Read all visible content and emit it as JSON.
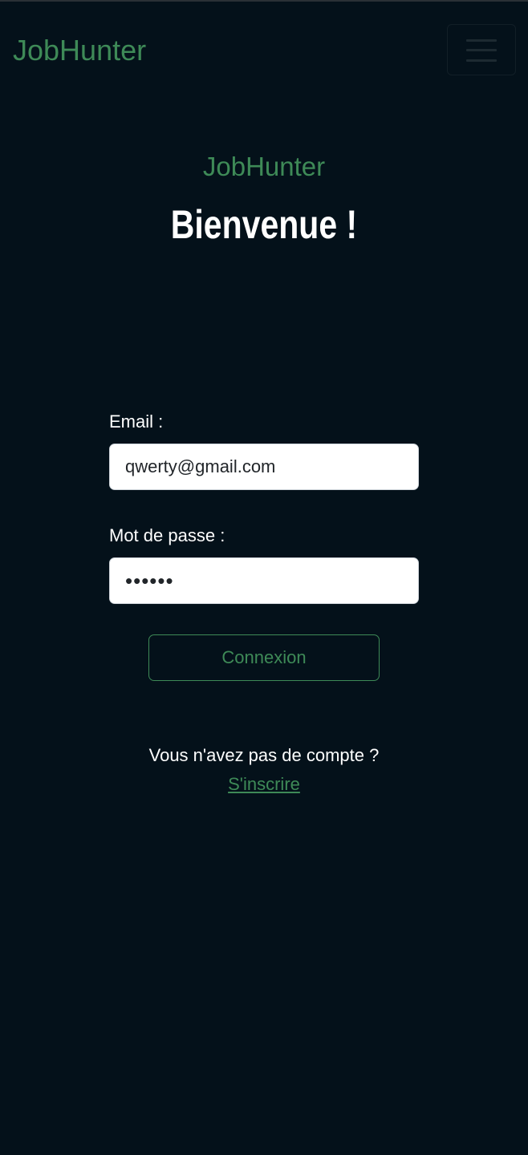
{
  "navbar": {
    "brand": "JobHunter",
    "menu_icon": "hamburger-menu-icon"
  },
  "hero": {
    "brand": "JobHunter",
    "title": "Bienvenue !"
  },
  "form": {
    "email_label": "Email :",
    "email_value": "qwerty@gmail.com",
    "password_label": "Mot de passe :",
    "password_value": "••••••",
    "submit_label": "Connexion"
  },
  "signup": {
    "prompt": "Vous n'avez pas de compte ?",
    "link_label": "S'inscrire"
  },
  "colors": {
    "background": "#04111a",
    "accent": "#3e8a57"
  }
}
